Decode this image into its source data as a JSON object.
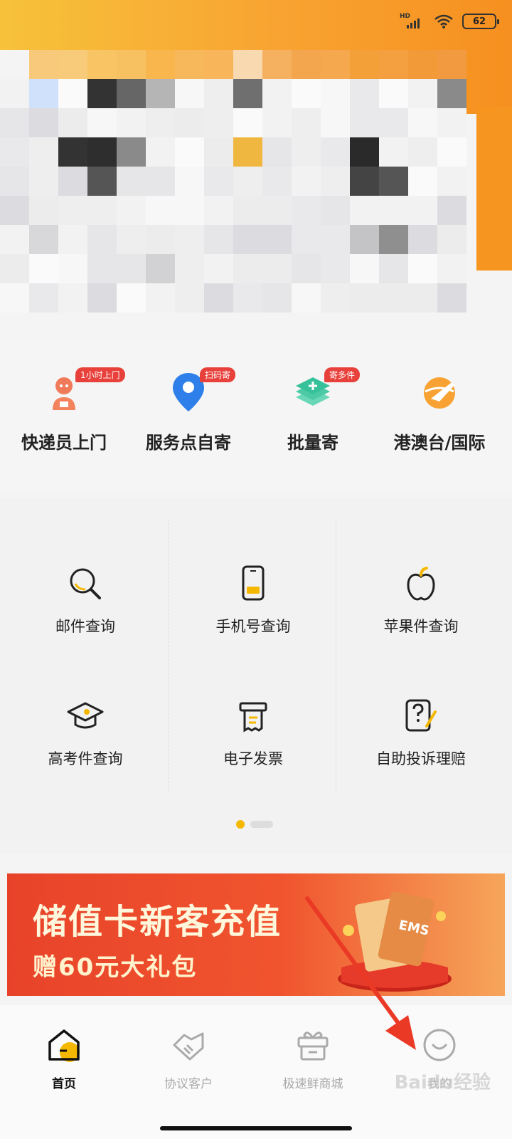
{
  "status_bar": {
    "network": "HD",
    "battery": "62"
  },
  "quick_actions": [
    {
      "label": "快递员上门",
      "badge": "1小时上门",
      "icon": "courier-icon"
    },
    {
      "label": "服务点自寄",
      "badge": "扫码寄",
      "icon": "location-pin-icon"
    },
    {
      "label": "批量寄",
      "badge": "寄多件",
      "icon": "layers-plus-icon"
    },
    {
      "label": "港澳台/国际",
      "badge": "",
      "icon": "globe-plane-icon"
    }
  ],
  "grid_items": [
    {
      "label": "邮件查询",
      "icon": "search-icon"
    },
    {
      "label": "手机号查询",
      "icon": "phone-icon"
    },
    {
      "label": "苹果件查询",
      "icon": "apple-icon"
    },
    {
      "label": "高考件查询",
      "icon": "graduation-cap-icon"
    },
    {
      "label": "电子发票",
      "icon": "receipt-icon"
    },
    {
      "label": "自助投诉理赔",
      "icon": "complaint-icon"
    }
  ],
  "pager": {
    "current": 1,
    "total": 2
  },
  "promo": {
    "title": "储值卡新客充值",
    "subtitle": "赠60元大礼包",
    "card_text": "EMS"
  },
  "nav": [
    {
      "label": "首页",
      "icon": "home-icon",
      "active": true
    },
    {
      "label": "协议客户",
      "icon": "handshake-icon",
      "active": false
    },
    {
      "label": "极速鲜商城",
      "icon": "gift-shop-icon",
      "active": false
    },
    {
      "label": "我的",
      "icon": "profile-smile-icon",
      "active": false
    }
  ],
  "watermark": "Baidu经验",
  "colors": {
    "accent": "#f5b800",
    "header_orange": "#f6951f",
    "badge_red": "#e8413b"
  }
}
